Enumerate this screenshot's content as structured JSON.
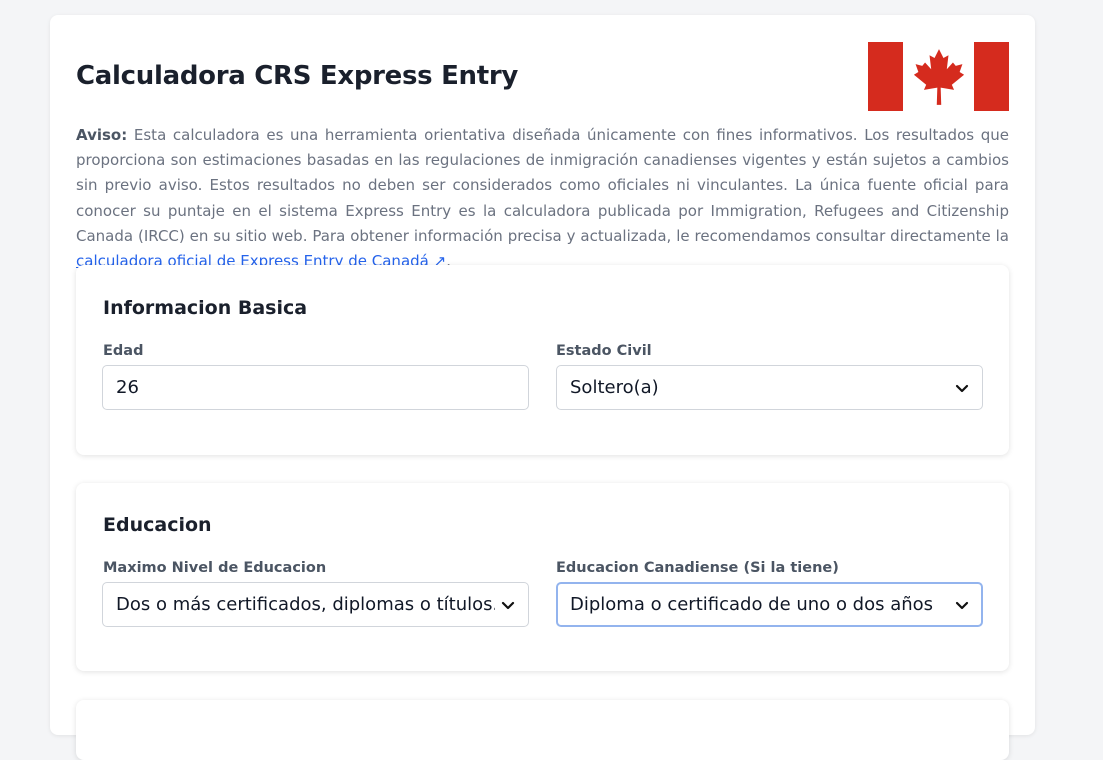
{
  "page": {
    "title": "Calculadora CRS Express Entry",
    "flag_colors": {
      "red": "#d52b1e",
      "white": "#ffffff"
    }
  },
  "disclaimer": {
    "label": "Aviso:",
    "text": " Esta calculadora es una herramienta orientativa diseñada únicamente con fines informativos. Los resultados que proporciona son estimaciones basadas en las regulaciones de inmigración canadienses vigentes y están sujetos a cambios sin previo aviso. Estos resultados no deben ser considerados como oficiales ni vinculantes. La única fuente oficial para conocer su puntaje en el sistema Express Entry es la calculadora publicada por Immigration, Refugees and Citizenship Canada (IRCC) en su sitio web. Para obtener información precisa y actualizada, le recomendamos consultar directamente la ",
    "link_text": "calculadora oficial de Express Entry de Canadá ↗",
    "end": "."
  },
  "basic_info": {
    "title": "Informacion Basica",
    "age_label": "Edad",
    "age_value": "26",
    "marital_label": "Estado Civil",
    "marital_value": "Soltero(a)"
  },
  "education": {
    "title": "Educacion",
    "max_level_label": "Maximo Nivel de Educacion",
    "max_level_value": "Dos o más certificados, diplomas o títulos. Uno de ellos debe ser de un programa de tres años o más",
    "canadian_label": "Educacion Canadiense (Si la tiene)",
    "canadian_value": "Diploma o certificado de uno o dos años"
  },
  "icons": {
    "dropdown": "chevron-down-icon",
    "flag": "canada-flag-icon",
    "external": "external-link-icon"
  }
}
